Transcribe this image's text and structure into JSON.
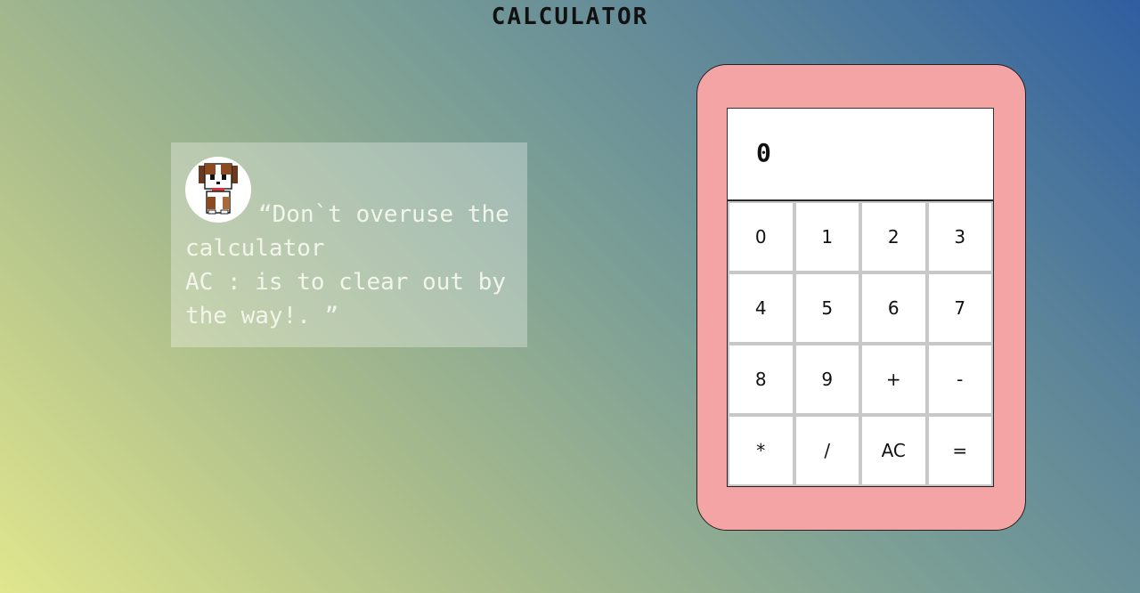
{
  "header": {
    "title": "CALCULATOR"
  },
  "quote": {
    "avatar_icon": "puppy-icon",
    "text": "“Don`t overuse the calculator\nAC : is to clear out by the way!. ”"
  },
  "calculator": {
    "display_value": "0",
    "keys": [
      "0",
      "1",
      "2",
      "3",
      "4",
      "5",
      "6",
      "7",
      "8",
      "9",
      "+",
      "-",
      "*",
      "/",
      "AC",
      "="
    ]
  }
}
